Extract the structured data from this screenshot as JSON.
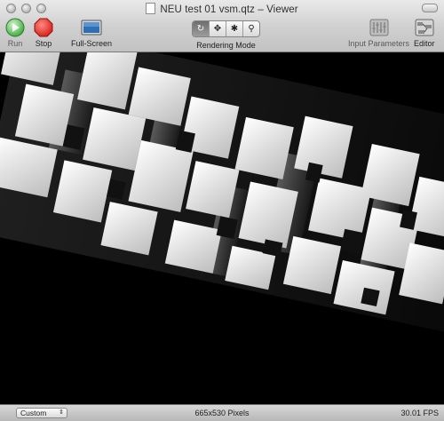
{
  "window": {
    "title": "NEU test 01 vsm.qtz – Viewer"
  },
  "toolbar": {
    "run_label": "Run",
    "stop_label": "Stop",
    "fullscreen_label": "Full-Screen",
    "rendering_mode_label": "Rendering Mode",
    "rendering_modes": [
      "refresh-icon",
      "move-icon",
      "bug-icon",
      "magnifier-icon"
    ],
    "selected_mode_index": 0,
    "input_parameters_label": "Input Parameters",
    "editor_label": "Editor"
  },
  "statusbar": {
    "size_preset": "Custom",
    "dimensions": "665x530 Pixels",
    "fps": "30.01 FPS"
  },
  "colors": {
    "run_green": "#3fae3f",
    "stop_red": "#d9251d",
    "fullscreen_blue": "#2f6fb5"
  }
}
